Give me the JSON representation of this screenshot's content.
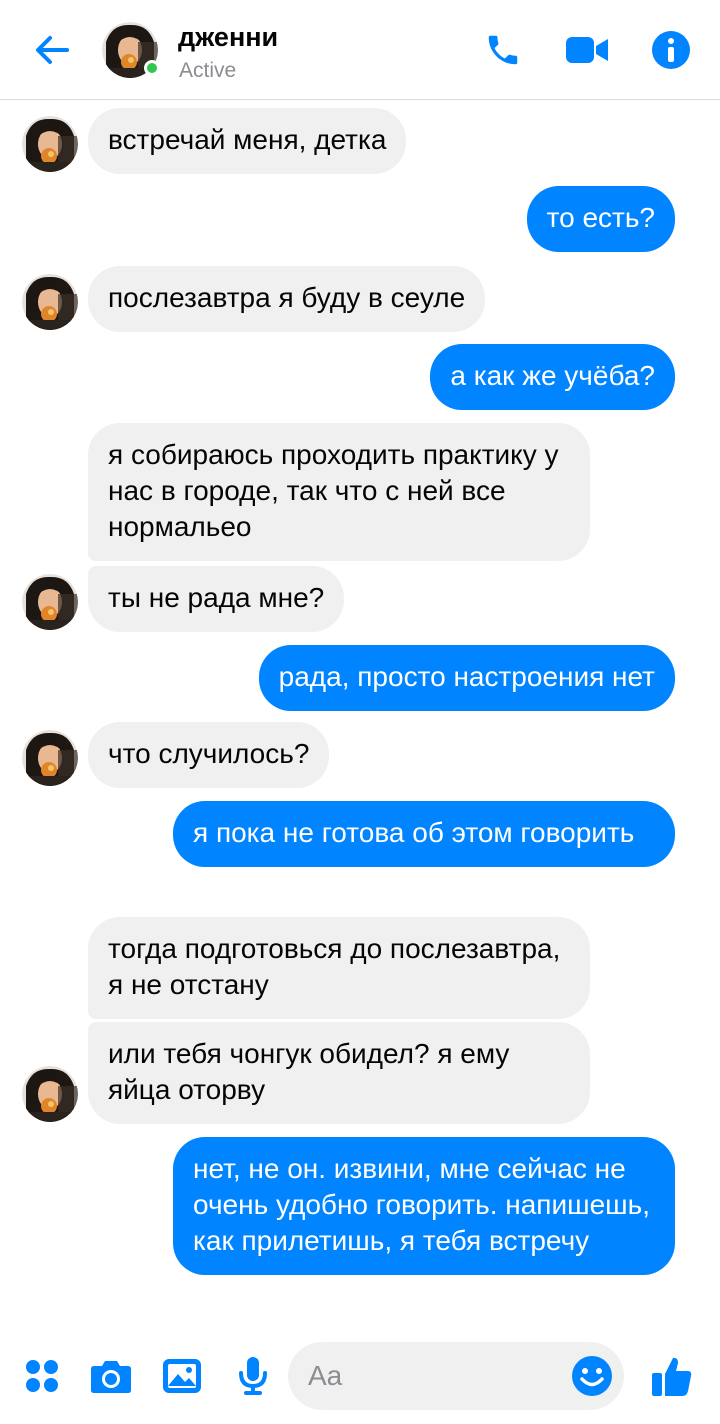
{
  "header": {
    "contact_name": "дженни",
    "status": "Active"
  },
  "colors": {
    "accent": "#0084ff",
    "incoming_bubble": "#f0f0f0",
    "online": "#31c750"
  },
  "icons": {
    "back": "arrow-left-icon",
    "call": "phone-icon",
    "video": "video-camera-icon",
    "info": "info-icon",
    "menu": "four-dots-icon",
    "camera": "camera-icon",
    "gallery": "image-icon",
    "voice": "microphone-icon",
    "emoji": "smiley-icon",
    "like": "thumbs-up-icon"
  },
  "messages": [
    {
      "from": "them",
      "text": "встречай меня, детка"
    },
    {
      "from": "me",
      "text": "то есть?"
    },
    {
      "from": "them",
      "text": "послезавтра я буду в сеуле"
    },
    {
      "from": "me",
      "text": "а как же учёба?"
    },
    {
      "from": "them",
      "text": "я собираюсь проходить практику у нас в городе, так что с ней все нормальео"
    },
    {
      "from": "them",
      "text": "ты не рада мне?"
    },
    {
      "from": "me",
      "text": "рада, просто настроения нет"
    },
    {
      "from": "them",
      "text": "что случилось?"
    },
    {
      "from": "me",
      "text": "я пока не готова об этом говорить"
    },
    {
      "from": "them",
      "text": "тогда подготовься до послезавтра, я не отстану"
    },
    {
      "from": "them",
      "text": "или тебя чонгук обидел? я ему яйца оторву"
    },
    {
      "from": "me",
      "text": "нет, не он. извини, мне сейчас не очень удобно говорить. напишешь, как прилетишь, я тебя встречу"
    }
  ],
  "composer": {
    "placeholder": "Aa"
  }
}
